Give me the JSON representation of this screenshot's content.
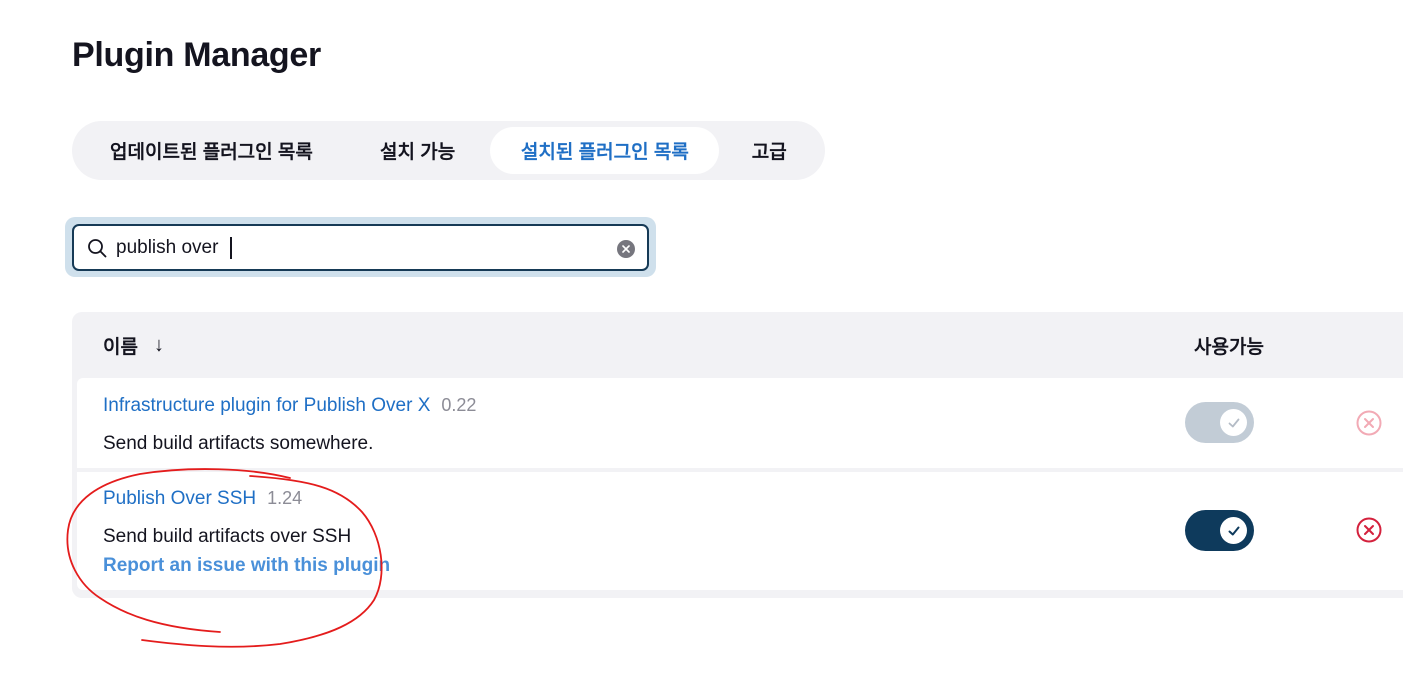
{
  "header": {
    "title": "Plugin Manager"
  },
  "tabs": [
    {
      "label": "업데이트된 플러그인 목록",
      "active": false
    },
    {
      "label": "설치 가능",
      "active": false
    },
    {
      "label": "설치된 플러그인 목록",
      "active": true
    },
    {
      "label": "고급",
      "active": false
    }
  ],
  "search": {
    "value": "publish over ",
    "icon": "search-icon",
    "clear_icon": "clear-icon"
  },
  "table": {
    "columns": {
      "name": "이름",
      "sort_indicator": "↓",
      "enabled": "사용가능"
    },
    "rows": [
      {
        "name": "Infrastructure plugin for Publish Over X",
        "version": "0.22",
        "description": "Send build artifacts somewhere.",
        "enabled": true,
        "toggle_disabled": true,
        "uninstall_available": false
      },
      {
        "name": "Publish Over SSH",
        "version": "1.24",
        "description": "Send build artifacts over SSH",
        "report_link": "Report an issue with this plugin",
        "enabled": true,
        "toggle_disabled": false,
        "uninstall_available": true
      }
    ]
  },
  "colors": {
    "accent": "#1f6fc5",
    "toggle_on": "#0e3a5c",
    "toggle_disabled": "#c2ccd6",
    "uninstall_red": "#d4213d",
    "annotation_red": "#e41c1c"
  }
}
